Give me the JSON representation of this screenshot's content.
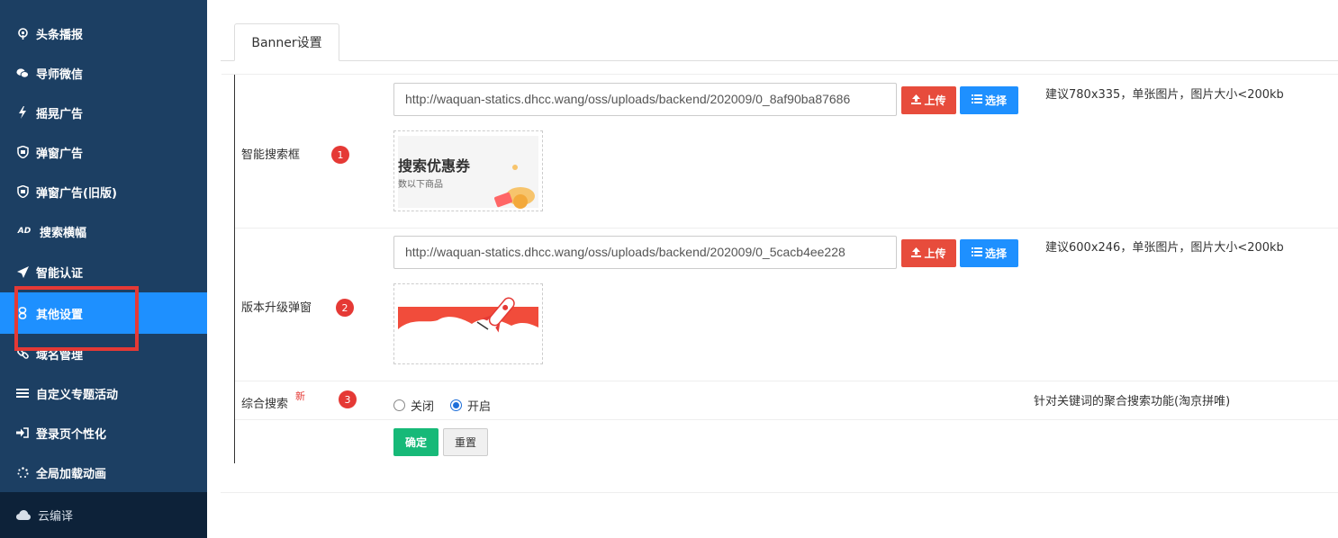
{
  "sidebar": {
    "items": [
      {
        "label": "头条播报",
        "icon": "broadcast-icon"
      },
      {
        "label": "导师微信",
        "icon": "wechat-icon"
      },
      {
        "label": "摇晃广告",
        "icon": "bolt-icon"
      },
      {
        "label": "弹窗广告",
        "icon": "popup-icon"
      },
      {
        "label": "弹窗广告(旧版)",
        "icon": "popup-old-icon"
      },
      {
        "label": "搜索横幅",
        "icon": "ad-icon"
      },
      {
        "label": "智能认证",
        "icon": "rocket-icon"
      },
      {
        "label": "其他设置",
        "icon": "link-icon",
        "active": true
      },
      {
        "label": "域名管理",
        "icon": "chain-icon"
      },
      {
        "label": "自定义专题活动",
        "icon": "list-icon"
      },
      {
        "label": "登录页个性化",
        "icon": "sign-in-icon"
      },
      {
        "label": "全局加载动画",
        "icon": "spinner-icon"
      }
    ],
    "cloud": {
      "label": "云编译",
      "icon": "cloud-icon"
    }
  },
  "tabs": [
    {
      "label": "Banner设置"
    }
  ],
  "rows": [
    {
      "label": "智能搜索框",
      "badge": "1",
      "url": "http://waquan-statics.dhcc.wang/oss/uploads/backend/202009/0_8af90ba87686",
      "upload_label": "上传",
      "select_label": "选择",
      "hint": "建议780x335，单张图片，图片大小<200kb",
      "preview": {
        "title": "搜索优惠券",
        "subtitle": "数以下商品"
      }
    },
    {
      "label": "版本升级弹窗",
      "badge": "2",
      "url": "http://waquan-statics.dhcc.wang/oss/uploads/backend/202009/0_5cacb4ee228",
      "upload_label": "上传",
      "select_label": "选择",
      "hint": "建议600x246，单张图片，图片大小<200kb"
    },
    {
      "label": "综合搜索",
      "new_tag": "新",
      "badge": "3",
      "options": [
        "关闭",
        "开启"
      ],
      "selected": "开启",
      "hint": "针对关键词的聚合搜索功能(淘京拼唯)"
    }
  ],
  "actions": {
    "confirm_label": "确定",
    "reset_label": "重置"
  },
  "colors": {
    "sidebar_bg": "#1c3f63",
    "active_bg": "#1e90ff",
    "upload_btn": "#e74c3c",
    "select_btn": "#1e90ff",
    "confirm_btn": "#17b978",
    "badge": "#e53935"
  }
}
